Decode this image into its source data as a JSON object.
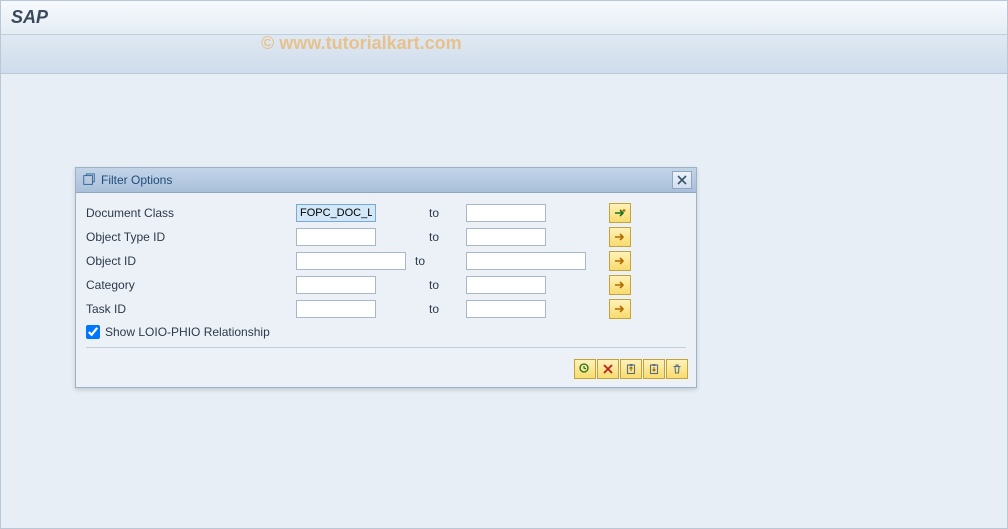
{
  "app": {
    "title": "SAP"
  },
  "watermark": "© www.tutorialkart.com",
  "dialog": {
    "title": "Filter Options",
    "fields": [
      {
        "label": "Document Class",
        "from": "FOPC_DOC_L",
        "to_label": "to",
        "to": "",
        "highlight": true,
        "wide": false
      },
      {
        "label": "Object Type ID",
        "from": "",
        "to_label": "to",
        "to": "",
        "highlight": false,
        "wide": false
      },
      {
        "label": "Object ID",
        "from": "",
        "to_label": "to",
        "to": "",
        "highlight": false,
        "wide": true
      },
      {
        "label": "Category",
        "from": "",
        "to_label": "to",
        "to": "",
        "highlight": false,
        "wide": false
      },
      {
        "label": "Task ID",
        "from": "",
        "to_label": "to",
        "to": "",
        "highlight": false,
        "wide": false
      }
    ],
    "checkbox_label": "Show LOIO-PHIO Relationship",
    "checkbox_checked": true
  }
}
